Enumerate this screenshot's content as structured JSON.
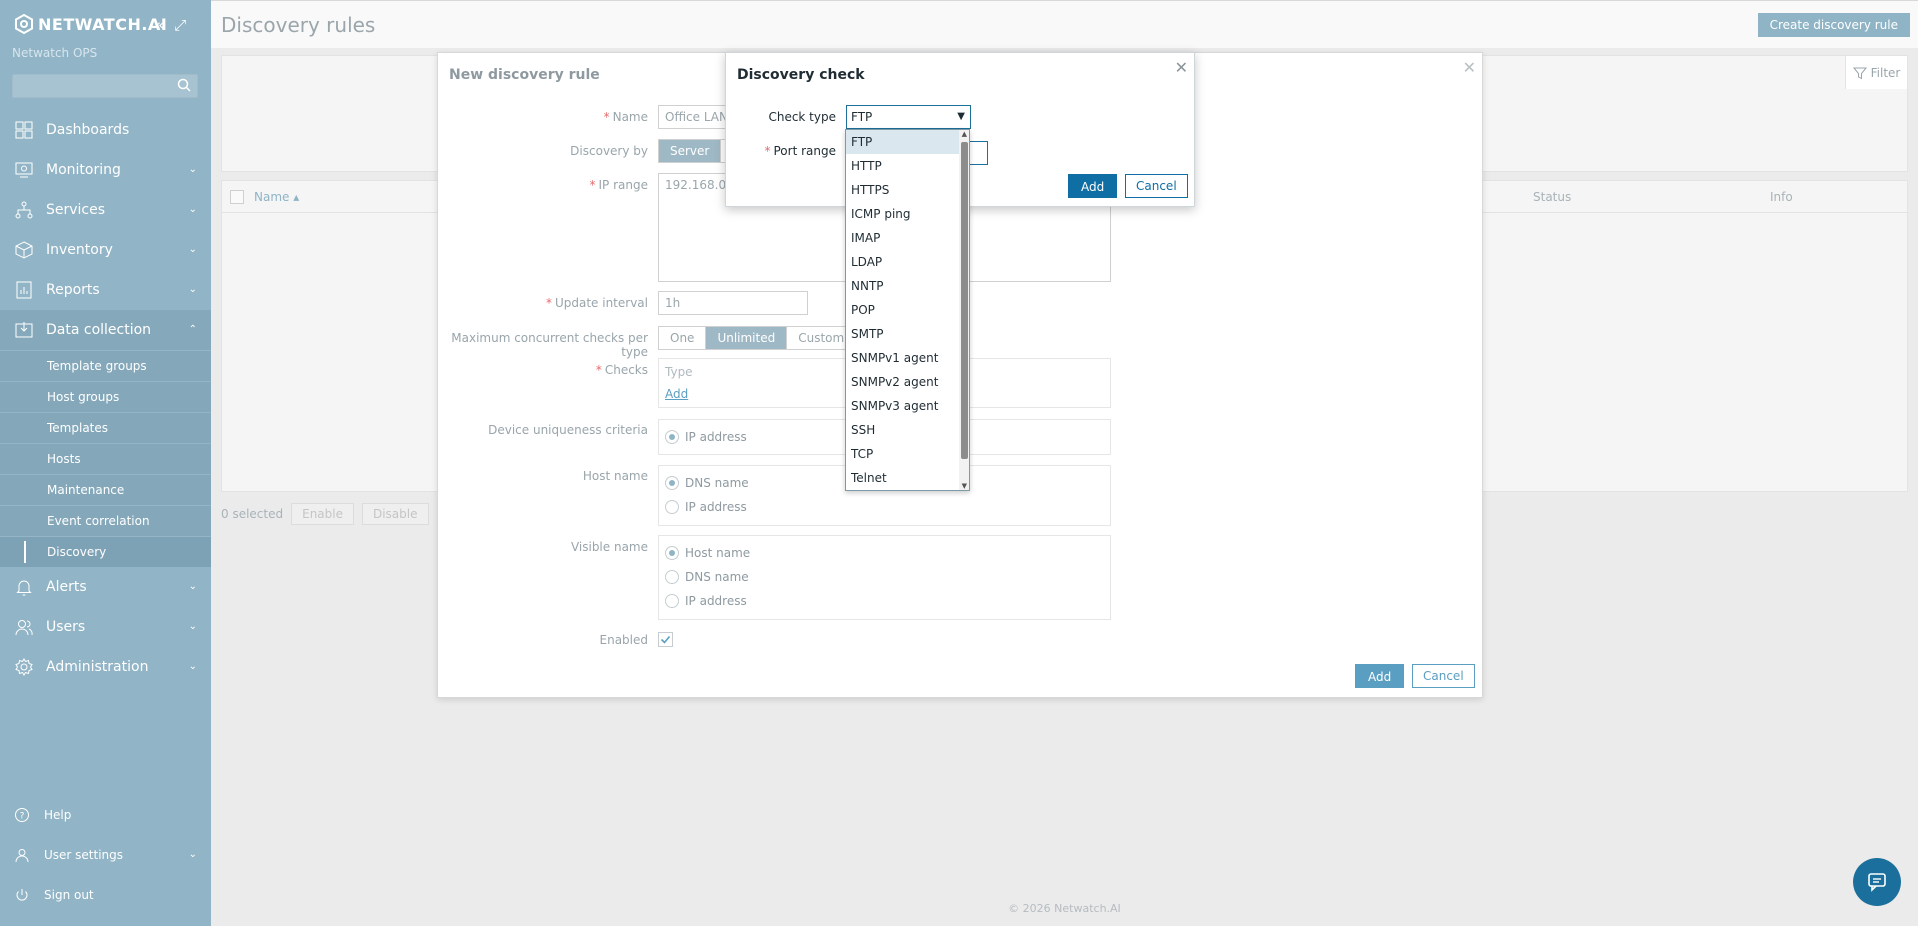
{
  "app": {
    "brand": "NETWATCH.AI",
    "subtitle": "Netwatch OPS",
    "search_placeholder": "",
    "accent": "#0f6ea3",
    "sidebar_bg": "#91b4c6"
  },
  "nav": {
    "items": [
      {
        "label": "Dashboards",
        "icon": "dashboard-icon"
      },
      {
        "label": "Monitoring",
        "icon": "monitor-icon"
      },
      {
        "label": "Services",
        "icon": "services-icon"
      },
      {
        "label": "Inventory",
        "icon": "inventory-icon"
      },
      {
        "label": "Reports",
        "icon": "reports-icon"
      },
      {
        "label": "Data collection",
        "icon": "data-collection-icon"
      },
      {
        "label": "Alerts",
        "icon": "bell-icon"
      },
      {
        "label": "Users",
        "icon": "users-icon"
      },
      {
        "label": "Administration",
        "icon": "gear-icon"
      }
    ],
    "sub_items": [
      "Template groups",
      "Host groups",
      "Templates",
      "Hosts",
      "Maintenance",
      "Event correlation",
      "Discovery"
    ],
    "bottom": [
      "Help",
      "User settings",
      "Sign out"
    ]
  },
  "page": {
    "title": "Discovery rules",
    "create_button": "Create discovery rule",
    "filter_label": "Filter",
    "table_headers": {
      "name": "Name ▴",
      "status": "Status",
      "info": "Info"
    },
    "selected_count": "0 selected",
    "enable_button": "Enable",
    "disable_button": "Disable",
    "copyright": "© 2026 Netwatch.AI"
  },
  "rule_dialog": {
    "title": "New discovery rule",
    "labels": {
      "name": "Name",
      "discovery_by": "Discovery by",
      "ip_range": "IP range",
      "update_interval": "Update interval",
      "max_checks": "Maximum concurrent checks per type",
      "checks": "Checks",
      "uniqueness": "Device uniqueness criteria",
      "host_name": "Host name",
      "visible_name": "Visible name",
      "enabled": "Enabled"
    },
    "values": {
      "name": "Office LAN",
      "discovery_by_selected": "Server",
      "ip_range": "192.168.0.1",
      "update_interval": "1h"
    },
    "max_checks_options": [
      "One",
      "Unlimited",
      "Custom"
    ],
    "checks_type_header": "Type",
    "checks_add_link": "Add",
    "uniqueness_options": [
      "IP address"
    ],
    "host_name_options": [
      "DNS name",
      "IP address"
    ],
    "visible_name_options": [
      "Host name",
      "DNS name",
      "IP address"
    ],
    "add_button": "Add",
    "cancel_button": "Cancel"
  },
  "check_dialog": {
    "title": "Discovery check",
    "check_type_label": "Check type",
    "port_range_label": "Port range",
    "selected": "FTP",
    "options": [
      "FTP",
      "HTTP",
      "HTTPS",
      "ICMP ping",
      "IMAP",
      "LDAP",
      "NNTP",
      "POP",
      "SMTP",
      "SNMPv1 agent",
      "SNMPv2 agent",
      "SNMPv3 agent",
      "SSH",
      "TCP",
      "Telnet"
    ],
    "add_button": "Add",
    "cancel_button": "Cancel"
  }
}
